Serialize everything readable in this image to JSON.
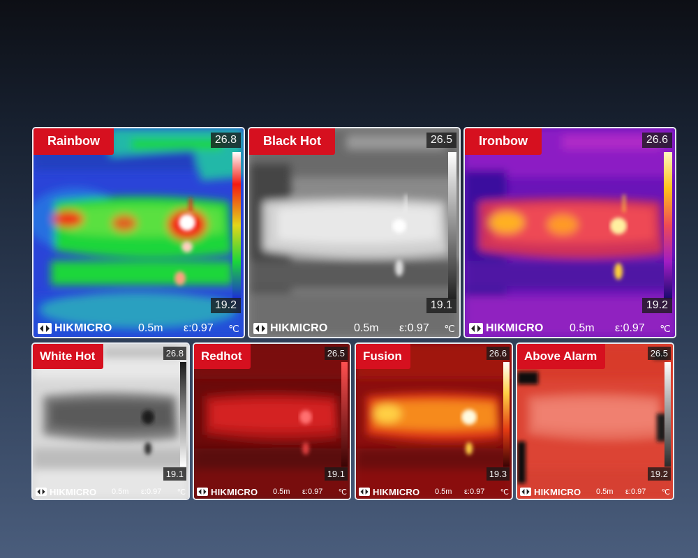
{
  "brand": "HIKMICRO",
  "distance": "0.5m",
  "emissivity": "ε:0.97",
  "unit": "℃",
  "panels": [
    {
      "label": "Rainbow",
      "max": "26.8",
      "min": "19.2"
    },
    {
      "label": "Black Hot",
      "max": "26.5",
      "min": "19.1"
    },
    {
      "label": "Ironbow",
      "max": "26.6",
      "min": "19.2"
    },
    {
      "label": "White Hot",
      "max": "26.8",
      "min": "19.1"
    },
    {
      "label": "Redhot",
      "max": "26.5",
      "min": "19.1"
    },
    {
      "label": "Fusion",
      "max": "26.6",
      "min": "19.3"
    },
    {
      "label": "Above Alarm",
      "max": "26.5",
      "min": "19.2"
    }
  ],
  "colors": {
    "badge": "#d6101f",
    "rainbow": [
      "#1c2fd6",
      "#1ad63a",
      "#f31a12",
      "#ffffff"
    ],
    "black_hot": [
      "#f2f2f2",
      "#777777",
      "#2a2a2a"
    ],
    "ironbow": [
      "#3b0b9e",
      "#b01cc4",
      "#ee4a55",
      "#ffd23a"
    ],
    "white_hot": [
      "#2a2a2a",
      "#999999",
      "#f2f2f2"
    ],
    "redhot": [
      "#4a0606",
      "#c01010",
      "#ff7070"
    ],
    "fusion": [
      "#6a0808",
      "#e23a12",
      "#ffd044",
      "#fffbe0"
    ],
    "above_alarm": [
      "#d8382c",
      "#f08070",
      "#ffffff"
    ]
  }
}
